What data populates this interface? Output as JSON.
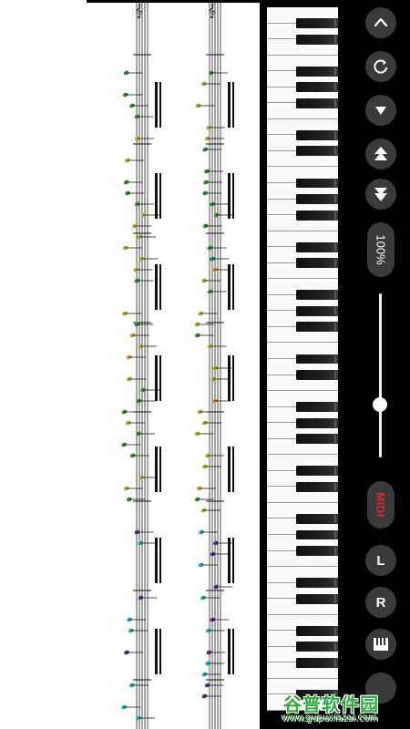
{
  "controls": {
    "collapse_icon": "chevron-up-icon",
    "replay_icon": "refresh-icon",
    "down_icon": "triangle-down-icon",
    "speed_up_icon": "speed-up-icon",
    "speed_down_icon": "speed-down-icon",
    "zoom_label": "100%",
    "slider_value": 0.68,
    "midi_label": "MIDI",
    "left_hand_label": "L",
    "right_hand_label": "R",
    "keyboard_icon": "piano-keys-icon"
  },
  "piano": {
    "orientation": "vertical",
    "white_key_count": 44
  },
  "score": {
    "staff_columns": 2,
    "note_colors": [
      "#b4a42a",
      "#2f8a2f",
      "#1fa7a7",
      "#5a2a8a"
    ]
  },
  "watermark": {
    "title": "谷普软件园",
    "url": "www.gupuxiazai.com"
  }
}
